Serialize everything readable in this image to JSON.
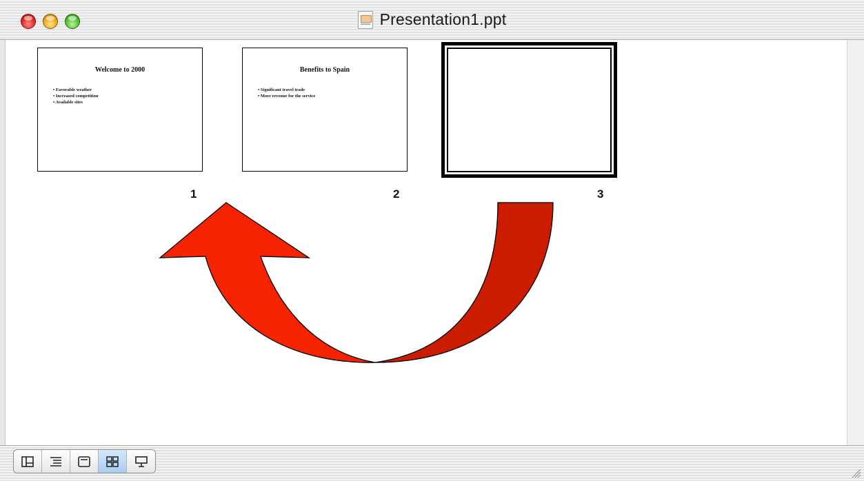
{
  "window": {
    "title": "Presentation1.ppt",
    "controls": [
      "close",
      "minimize",
      "zoom"
    ]
  },
  "slides": [
    {
      "number": "1",
      "title": "Welcome to 2000",
      "bullets": [
        "Favorable weather",
        "Increased competition",
        "Available sites"
      ],
      "selected": false
    },
    {
      "number": "2",
      "title": "Benefits to Spain",
      "bullets": [
        "Significant travel trade",
        "More revenue for the service"
      ],
      "selected": false
    },
    {
      "number": "3",
      "title": "",
      "bullets": [],
      "selected": true
    }
  ],
  "annotation": {
    "type": "curved-arrow",
    "from_slide": "3",
    "to_slide": "1",
    "colors": {
      "light": "#f52300",
      "dark": "#cc1c00"
    }
  },
  "view_buttons": [
    {
      "name": "normal-view",
      "icon": "normal-view-icon",
      "active": false
    },
    {
      "name": "outline-view",
      "icon": "outline-view-icon",
      "active": false
    },
    {
      "name": "slide-view",
      "icon": "slide-view-icon",
      "active": false
    },
    {
      "name": "slide-sorter-view",
      "icon": "slide-sorter-icon",
      "active": true
    },
    {
      "name": "slide-show",
      "icon": "slide-show-icon",
      "active": false
    }
  ]
}
